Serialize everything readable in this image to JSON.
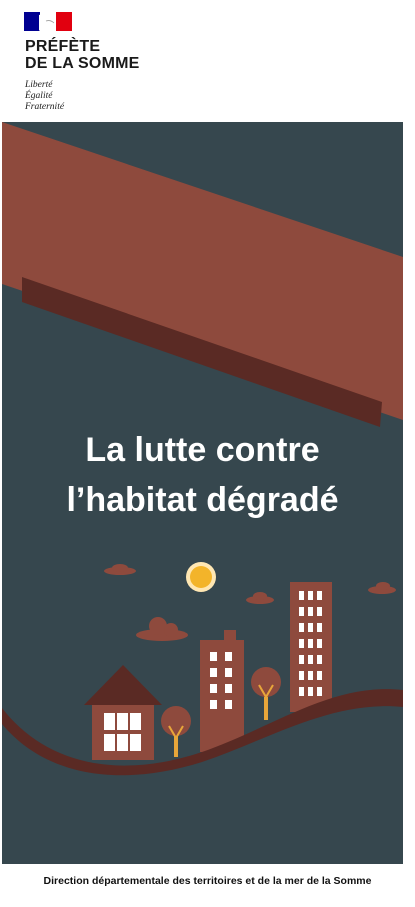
{
  "header": {
    "prefecture_line1": "PRÉFÈTE",
    "prefecture_line2": "DE LA SOMME",
    "motto_line1": "Liberté",
    "motto_line2": "Égalité",
    "motto_line3": "Fraternité"
  },
  "cover": {
    "title_line1": "La lutte contre",
    "title_line2": "l’habitat dégradé"
  },
  "footer": {
    "text": "Direction départementale des territoires et de la mer de la Somme"
  },
  "colors": {
    "brick": "#8e4a3d",
    "slate": "#36474e",
    "dark_band": "#5a2a24",
    "sun": "#f3b42a",
    "tree_trunk": "#e8a63a",
    "window": "#ffffff",
    "flag_blue": "#000091",
    "flag_red": "#e1000f"
  },
  "icons": {
    "flag": "marianne-flag-icon"
  }
}
